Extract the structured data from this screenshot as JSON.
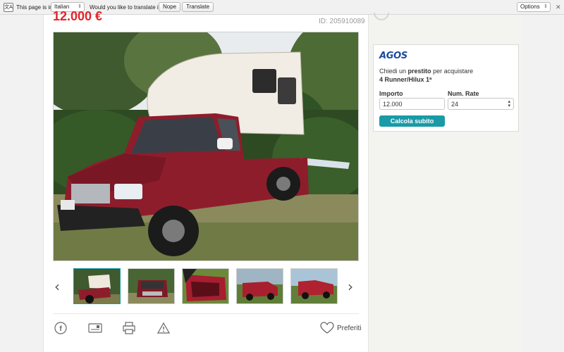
{
  "translate_bar": {
    "prefix": "This page is in",
    "language": "Italian",
    "question": "Would you like to translate it?",
    "nope": "Nope",
    "translate": "Translate",
    "options": "Options"
  },
  "listing": {
    "price": "12.000 €",
    "ad_id": "ID: 205910089",
    "thumbnail_count": 5,
    "favorites_label": "Preferiti"
  },
  "loan": {
    "brand": "AGOS",
    "line1_prefix": "Chiedi un",
    "line1_bold": "prestito",
    "line1_suffix": "per acquistare",
    "model": "4 Runner/Hilux 1ª",
    "amount_label": "Importo",
    "amount_value": "12.000",
    "installments_label": "Num. Rate",
    "installments_value": "24",
    "cta": "Calcola subito"
  },
  "colors": {
    "accent": "#1a9aa7",
    "price": "#e4232a",
    "truck": "#8e1d2c"
  }
}
